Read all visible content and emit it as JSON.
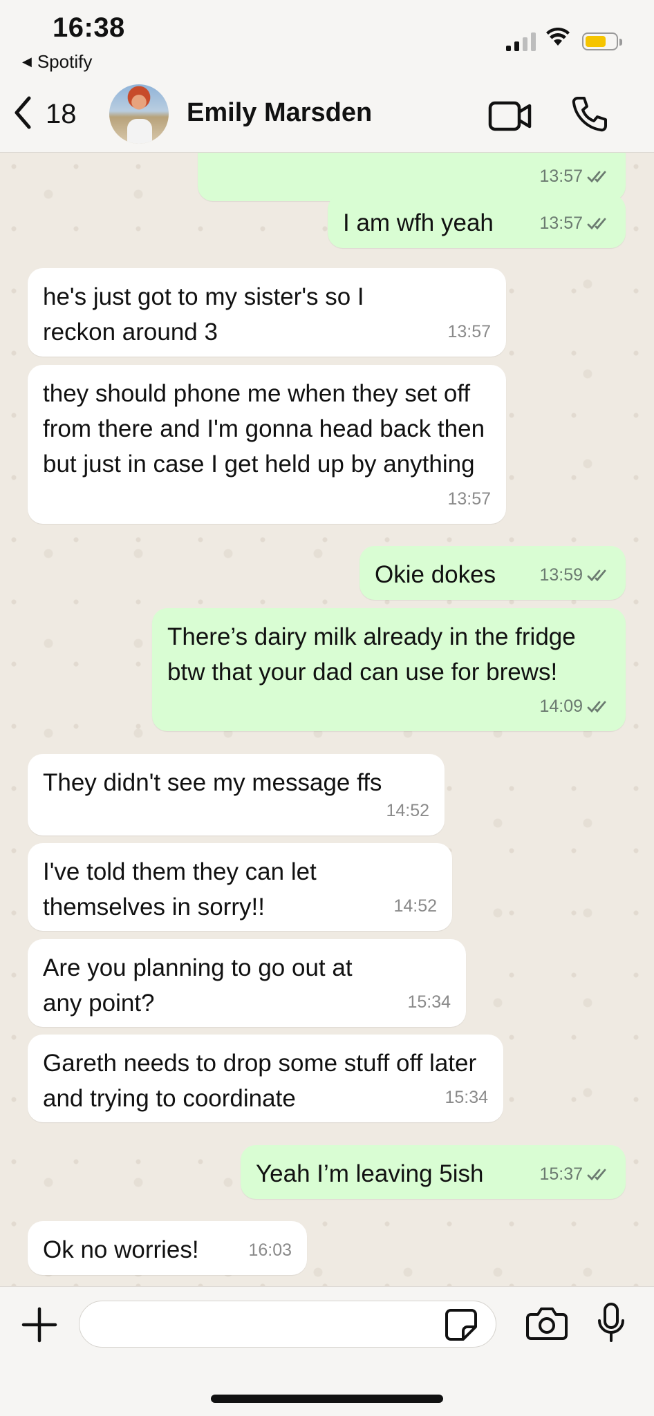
{
  "status_bar": {
    "time": "16:38",
    "back_app": "Spotify",
    "battery_color": "#f5c400"
  },
  "header": {
    "back_count": "18",
    "contact_name": "Emily Marsden",
    "icons": [
      "chevron-left-icon",
      "video-camera-icon",
      "phone-icon"
    ]
  },
  "messages": [
    {
      "dir": "out",
      "text": "",
      "time": "13:57",
      "read": true
    },
    {
      "dir": "out",
      "text": "I am wfh yeah",
      "time": "13:57",
      "read": true
    },
    {
      "dir": "in",
      "text": "he's just got to my sister's so I reckon around 3",
      "time": "13:57"
    },
    {
      "dir": "in",
      "text": "they should phone me when they set off from there and I'm gonna head back then but just in case I get held up by anything",
      "time": "13:57"
    },
    {
      "dir": "out",
      "text": "Okie dokes",
      "time": "13:59",
      "read": true
    },
    {
      "dir": "out",
      "text": "There’s dairy milk already in the fridge btw that your dad can use for brews!",
      "time": "14:09",
      "read": true
    },
    {
      "dir": "in",
      "text": "They didn't see my message ffs",
      "time": "14:52"
    },
    {
      "dir": "in",
      "text": "I've told them they can let themselves in sorry!!",
      "time": "14:52"
    },
    {
      "dir": "in",
      "text": "Are you planning to go out at any point?",
      "time": "15:34"
    },
    {
      "dir": "in",
      "text": "Gareth needs to drop some stuff off later and trying to coordinate",
      "time": "15:34"
    },
    {
      "dir": "out",
      "text": "Yeah I’m leaving 5ish",
      "time": "15:37",
      "read": true
    },
    {
      "dir": "in",
      "text": "Ok no worries!",
      "time": "16:03"
    }
  ],
  "input_bar": {
    "placeholder": "",
    "icons": [
      "plus-icon",
      "sticker-icon",
      "camera-icon",
      "microphone-icon"
    ]
  },
  "colors": {
    "outgoing_bubble": "#d9fdd3",
    "incoming_bubble": "#ffffff",
    "chat_background": "#efeae2",
    "read_tick": "#6b7a70"
  }
}
